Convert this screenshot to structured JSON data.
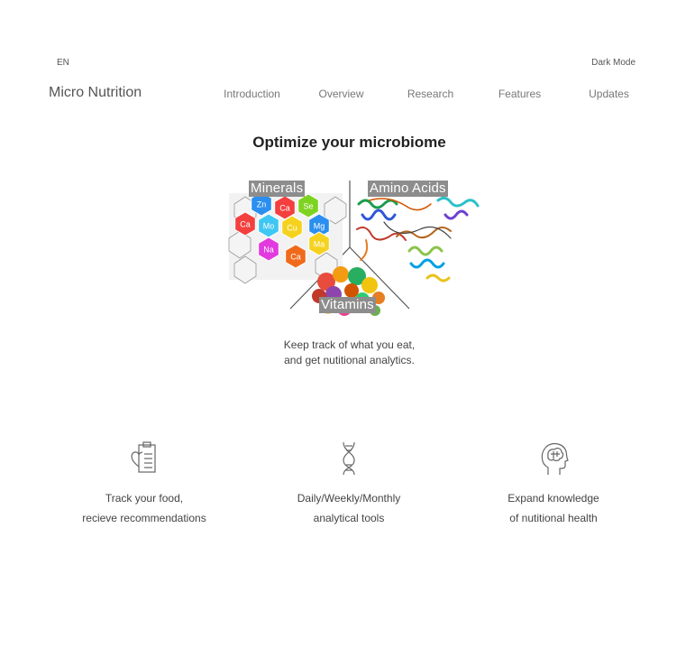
{
  "header": {
    "language": "EN",
    "dark_mode_label": "Dark Mode",
    "brand": "Micro Nutrition",
    "nav": [
      "Introduction",
      "Overview",
      "Research",
      "Features",
      "Updates"
    ]
  },
  "hero": {
    "title": "Optimize your microbiome",
    "panels": {
      "minerals": "Minerals",
      "amino": "Amino Acids",
      "vitamins": "Vitamins"
    },
    "mineral_symbols": [
      "Zn",
      "Ca",
      "Se",
      "Ca",
      "Mo",
      "Cu",
      "Mg",
      "Na",
      "Ca",
      "Ma"
    ],
    "tagline_line1": "Keep track of what you eat,",
    "tagline_line2": "and get nutitional analytics."
  },
  "features": [
    {
      "icon": "heart-clipboard-icon",
      "line1": "Track your food,",
      "line2": "recieve recommendations"
    },
    {
      "icon": "dna-icon",
      "line1": "Daily/Weekly/Monthly",
      "line2": "analytical tools"
    },
    {
      "icon": "brain-head-icon",
      "line1": "Expand knowledge",
      "line2": "of nutitional health"
    }
  ],
  "colors": {
    "text": "#333333",
    "nav": "#777777",
    "label_bg": "#8d8d8d",
    "hex_colors": [
      "#2b8ff0",
      "#f43f3f",
      "#7ed321",
      "#f5d21e",
      "#3fc7f3",
      "#e23adf",
      "#f06a1c",
      "#2ec4e8"
    ]
  }
}
